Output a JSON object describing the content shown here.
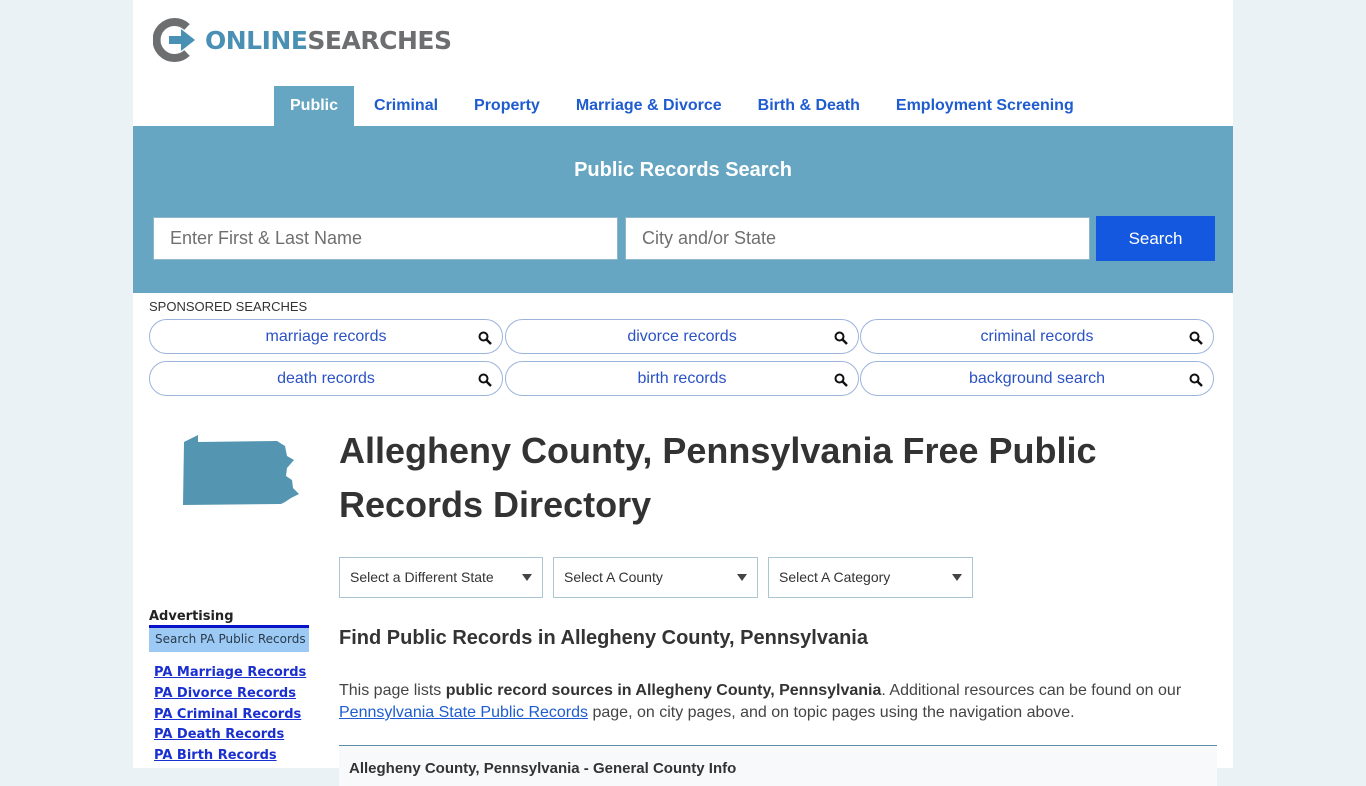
{
  "brand": {
    "logo_part1": "ONLINE",
    "logo_part2": "SEARCHES"
  },
  "nav": {
    "items": [
      {
        "label": "Public",
        "active": true
      },
      {
        "label": "Criminal"
      },
      {
        "label": "Property"
      },
      {
        "label": "Marriage & Divorce"
      },
      {
        "label": "Birth & Death"
      },
      {
        "label": "Employment Screening"
      }
    ]
  },
  "hero": {
    "title": "Public Records Search",
    "name_placeholder": "Enter First & Last Name",
    "name_value": "",
    "city_placeholder": "City and/or State",
    "city_value": "",
    "search_label": "Search"
  },
  "sponsored": {
    "label": "SPONSORED SEARCHES",
    "items": [
      "marriage records",
      "divorce records",
      "criminal records",
      "death records",
      "birth records",
      "background search"
    ],
    "icon": "search-icon"
  },
  "sidebar": {
    "map_icon": "pennsylvania-state-icon",
    "advertising_label": "Advertising",
    "box_label": "Search PA Public Records",
    "links": [
      "PA Marriage Records",
      "PA Divorce Records",
      "PA Criminal Records",
      "PA Death Records",
      "PA Birth Records"
    ]
  },
  "main": {
    "title": "Allegheny County, Pennsylvania Free Public Records Directory",
    "selects": [
      "Select a Different State",
      "Select A County",
      "Select A Category"
    ],
    "find_heading": "Find Public Records in Allegheny County, Pennsylvania",
    "intro_pre": "This page lists ",
    "intro_bold": "public record sources in Allegheny County, Pennsylvania",
    "intro_mid": ". Additional resources can be found on our ",
    "intro_link": "Pennsylvania State Public Records",
    "intro_post": " page, on city pages, and on topic pages using the navigation above.",
    "info_box_title": "Allegheny County, Pennsylvania - General County Info"
  },
  "colors": {
    "accent": "#67a6c2",
    "nav_link": "#1e5ccf",
    "search_button": "#1558e0",
    "sidebar_link": "#1a2fcf",
    "map_fill": "#5495b1"
  }
}
